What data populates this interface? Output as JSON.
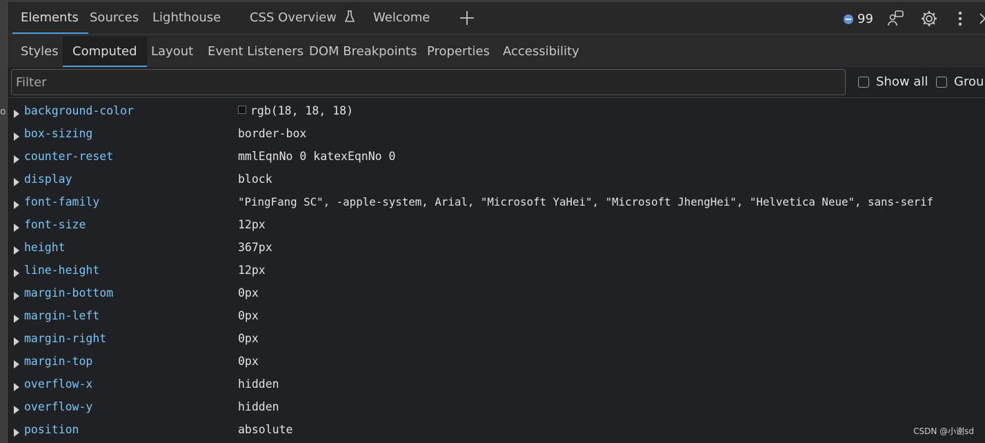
{
  "gutter_glyph": "o",
  "main_tabs": [
    {
      "label": "Elements"
    },
    {
      "label": "Sources"
    },
    {
      "label": "Lighthouse"
    },
    {
      "label": "CSS Overview"
    },
    {
      "label": "Welcome"
    }
  ],
  "toolbar": {
    "issues_count": "99",
    "issues_icon": "message-bubble-icon",
    "customize_icon": "people-icon",
    "settings_icon": "gear-icon",
    "more_icon": "kebab-icon",
    "close_icon": "close-icon"
  },
  "sub_tabs": [
    {
      "label": "Styles"
    },
    {
      "label": "Computed"
    },
    {
      "label": "Layout"
    },
    {
      "label": "Event Listeners"
    },
    {
      "label": "DOM Breakpoints"
    },
    {
      "label": "Properties"
    },
    {
      "label": "Accessibility"
    }
  ],
  "filter": {
    "placeholder": "Filter",
    "value": ""
  },
  "checkboxes": {
    "show_all": "Show all",
    "group": "Group"
  },
  "properties": [
    {
      "name": "background-color",
      "value": "rgb(18, 18, 18)"
    },
    {
      "name": "box-sizing",
      "value": "border-box"
    },
    {
      "name": "counter-reset",
      "value": "mmlEqnNo 0 katexEqnNo 0"
    },
    {
      "name": "display",
      "value": "block"
    },
    {
      "name": "font-family",
      "value": "\"PingFang SC\", -apple-system, Arial, \"Microsoft YaHei\", \"Microsoft JhengHei\", \"Helvetica Neue\", sans-serif"
    },
    {
      "name": "font-size",
      "value": "12px"
    },
    {
      "name": "height",
      "value": "367px"
    },
    {
      "name": "line-height",
      "value": "12px"
    },
    {
      "name": "margin-bottom",
      "value": "0px"
    },
    {
      "name": "margin-left",
      "value": "0px"
    },
    {
      "name": "margin-right",
      "value": "0px"
    },
    {
      "name": "margin-top",
      "value": "0px"
    },
    {
      "name": "overflow-x",
      "value": "hidden"
    },
    {
      "name": "overflow-y",
      "value": "hidden"
    },
    {
      "name": "position",
      "value": "absolute"
    }
  ],
  "watermark": "CSDN @小谢sd",
  "colors": {
    "accent": "#4b9be0",
    "property_name": "#7cc4f4",
    "background": "#202124",
    "swatch": "#121212"
  }
}
